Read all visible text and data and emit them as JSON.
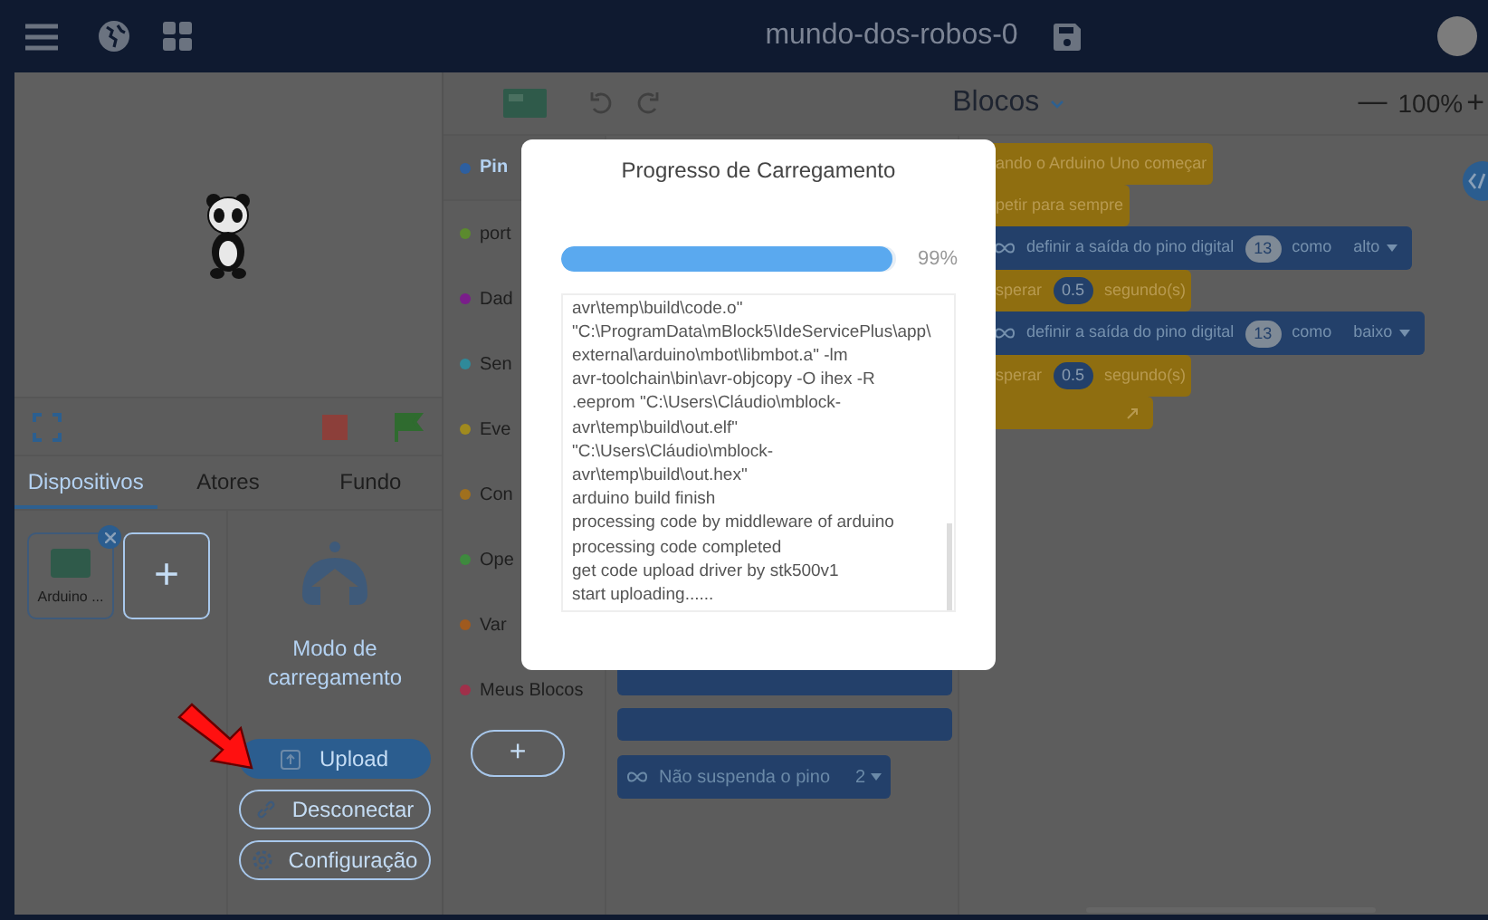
{
  "app_bar": {
    "title": "mundo-dos-robos-0"
  },
  "sprite_tabs": [
    {
      "label": "Dispositivos",
      "selected": true
    },
    {
      "label": "Atores",
      "selected": false
    },
    {
      "label": "Fundo",
      "selected": false
    }
  ],
  "devices": [
    {
      "name": "Arduino ..."
    }
  ],
  "add_device_button": "+",
  "upload_mode": {
    "label": "Modo de carregamento",
    "buttons": [
      {
        "label": "Upload",
        "kind": "primary"
      },
      {
        "label": "Desconectar",
        "kind": "link"
      },
      {
        "label": "Configuração",
        "kind": "settings"
      }
    ]
  },
  "toolbar": {
    "view": "Blocos",
    "zoom_out": "—",
    "zoom": "100%",
    "zoom_in": "+"
  },
  "add_extension_button": "+",
  "categories": [
    {
      "label": "Pin",
      "color": "#2d5fa0",
      "selected": true
    },
    {
      "label": "port",
      "color": "#5b8a2e",
      "selected": false
    },
    {
      "label": "Dad",
      "color": "#7a1e8a",
      "selected": false
    },
    {
      "label": "Sen",
      "color": "#2f8a9a",
      "selected": false
    },
    {
      "label": "Eve",
      "color": "#a08a1e",
      "selected": false
    },
    {
      "label": "Con",
      "color": "#a0701e",
      "selected": false
    },
    {
      "label": "Ope",
      "color": "#3e8a3e",
      "selected": false
    },
    {
      "label": "Var",
      "color": "#a05a1e",
      "selected": false
    },
    {
      "label": "Meus Blocos",
      "color": "#a0304a",
      "selected": false
    }
  ],
  "palette_blocks": [
    {
      "label": "Não suspenda o pino",
      "value": "2"
    }
  ],
  "script": [
    {
      "kind": "control",
      "parts": [
        {
          "kind": "text",
          "text": "ando o Arduino Uno começar"
        }
      ]
    },
    {
      "kind": "control",
      "parts": [
        {
          "kind": "text",
          "text": "petir para sempre"
        }
      ]
    },
    {
      "kind": "pin",
      "parts": [
        {
          "kind": "text",
          "text": "definir a saída do pino digital"
        },
        {
          "kind": "number",
          "text": "13"
        },
        {
          "kind": "text",
          "text": "como"
        },
        {
          "kind": "menu",
          "text": "alto"
        }
      ]
    },
    {
      "kind": "control",
      "parts": [
        {
          "kind": "text",
          "text": "sperar"
        },
        {
          "kind": "number",
          "text": "0.5"
        },
        {
          "kind": "text",
          "text": "segundo(s)"
        }
      ]
    },
    {
      "kind": "pin",
      "parts": [
        {
          "kind": "text",
          "text": "definir a saída do pino digital"
        },
        {
          "kind": "number",
          "text": "13"
        },
        {
          "kind": "text",
          "text": "como"
        },
        {
          "kind": "menu",
          "text": "baixo"
        }
      ]
    },
    {
      "kind": "control",
      "parts": [
        {
          "kind": "text",
          "text": "sperar"
        },
        {
          "kind": "number",
          "text": "0.5"
        },
        {
          "kind": "text",
          "text": "segundo(s)"
        }
      ]
    },
    {
      "kind": "end"
    }
  ],
  "modal": {
    "title": "Progresso de Carregamento",
    "level": 0.99,
    "percent": "99%",
    "log": [
      "avr\\temp\\build\\code.o\"",
      "\"C:\\ProgramData\\mBlock5\\IdeServicePlus\\app\\",
      "external\\arduino\\mbot\\libmbot.a\" -lm",
      "avr-toolchain\\bin\\avr-objcopy -O ihex -R",
      ".eeprom \"C:\\Users\\Cláudio\\mblock-",
      "avr\\temp\\build\\out.elf\"",
      "\"C:\\Users\\Cláudio\\mblock-",
      "avr\\temp\\build\\out.hex\"",
      "arduino build finish",
      "processing code by middleware of arduino",
      "processing code completed",
      "get code upload driver by stk500v1",
      "start uploading......"
    ]
  }
}
